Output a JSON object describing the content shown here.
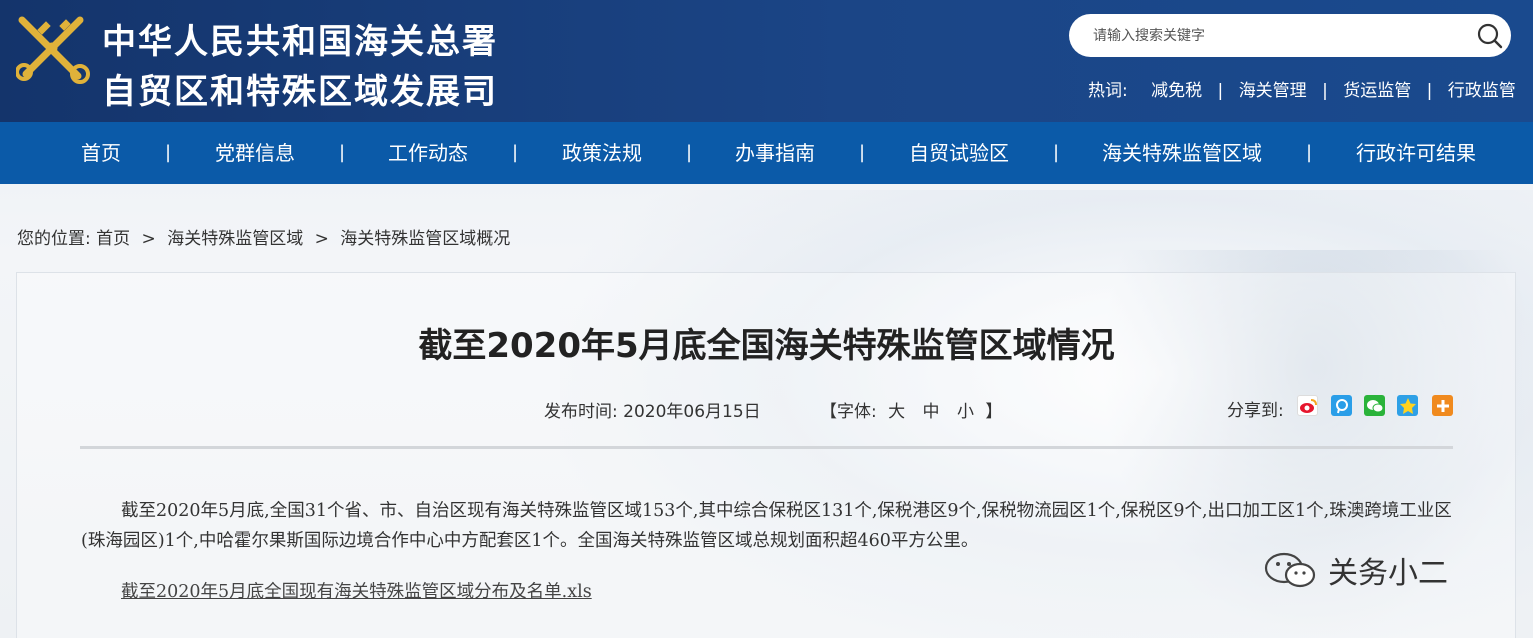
{
  "header": {
    "title_line1": "中华人民共和国海关总署",
    "title_line2": "自贸区和特殊区域发展司",
    "logo_icon": "customs-emblem-icon",
    "search": {
      "placeholder": "请输入搜索关键字",
      "icon": "search-icon"
    },
    "hotwords": {
      "label": "热词:",
      "items": [
        "减免税",
        "海关管理",
        "货运监管",
        "行政监管"
      ],
      "separator": "|"
    }
  },
  "nav": {
    "items": [
      "首页",
      "党群信息",
      "工作动态",
      "政策法规",
      "办事指南",
      "自贸试验区",
      "海关特殊监管区域",
      "行政许可结果"
    ],
    "separator": "|"
  },
  "breadcrumb": {
    "label": "您的位置:",
    "items": [
      "首页",
      "海关特殊监管区域",
      "海关特殊监管区域概况"
    ],
    "arrow": ">"
  },
  "article": {
    "title": "截至2020年5月底全国海关特殊监管区域情况",
    "publish_label": "发布时间:",
    "publish_date": "2020年06月15日",
    "font_label_open": "【字体:",
    "font_sizes": [
      "大",
      "中",
      "小"
    ],
    "font_label_close": "】",
    "share_label": "分享到:",
    "share_icons": [
      "weibo-icon",
      "tencent-weibo-icon",
      "wechat-icon",
      "qzone-icon",
      "more-icon"
    ],
    "body": "截至2020年5月底,全国31个省、市、自治区现有海关特殊监管区域153个,其中综合保税区131个,保税港区9个,保税物流园区1个,保税区9个,出口加工区1个,珠澳跨境工业区(珠海园区)1个,中哈霍尔果斯国际边境合作中心中方配套区1个。全国海关特殊监管区域总规划面积超460平方公里。",
    "attachment": "截至2020年5月底全国现有海关特殊监管区域分布及名单.xls"
  },
  "wechat_watermark": "关务小二",
  "colors": {
    "header": "#1b4586",
    "nav": "#0b5aa8"
  }
}
